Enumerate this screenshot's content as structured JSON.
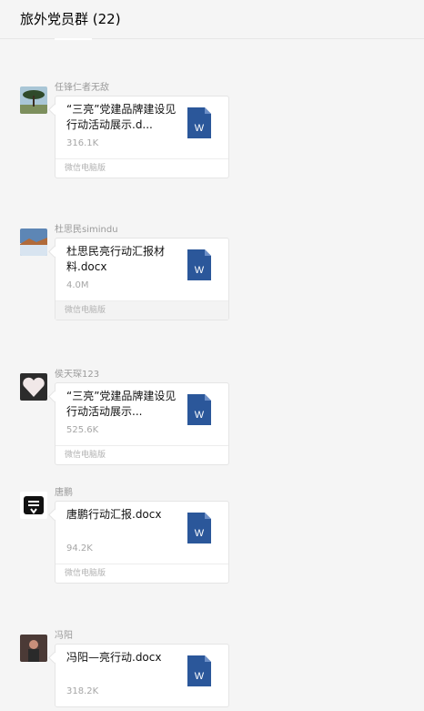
{
  "header": {
    "title": "旅外党员群 (22)"
  },
  "messages": [
    {
      "sender": "任锋仁者无敌",
      "file_name": "“三亮”党建品牌建设见行动活动展示.d...",
      "file_size": "316.1K",
      "source": "微信电脑版",
      "avatar": "tree-landscape"
    },
    {
      "sender": "杜思民simindu",
      "file_name": "杜思民亮行动汇报材料.docx",
      "file_size": "4.0M",
      "source": "微信电脑版",
      "avatar": "lake-sunset"
    },
    {
      "sender": "侯天琛123",
      "file_name": "“三亮”党建品牌建设见行动活动展示...",
      "file_size": "525.6K",
      "source": "微信电脑版",
      "avatar": "heart-photo"
    },
    {
      "sender": "唐鹏",
      "file_name": "唐鹏行动汇报.docx",
      "file_size": "94.2K",
      "source": "微信电脑版",
      "avatar": "chinese-char-logo"
    },
    {
      "sender": "冯阳",
      "file_name": "冯阳—亮行动.docx",
      "file_size": "318.2K",
      "source": "",
      "avatar": "person-portrait"
    }
  ],
  "colors": {
    "word_blue": "#2b579a",
    "background": "#f5f5f5"
  }
}
